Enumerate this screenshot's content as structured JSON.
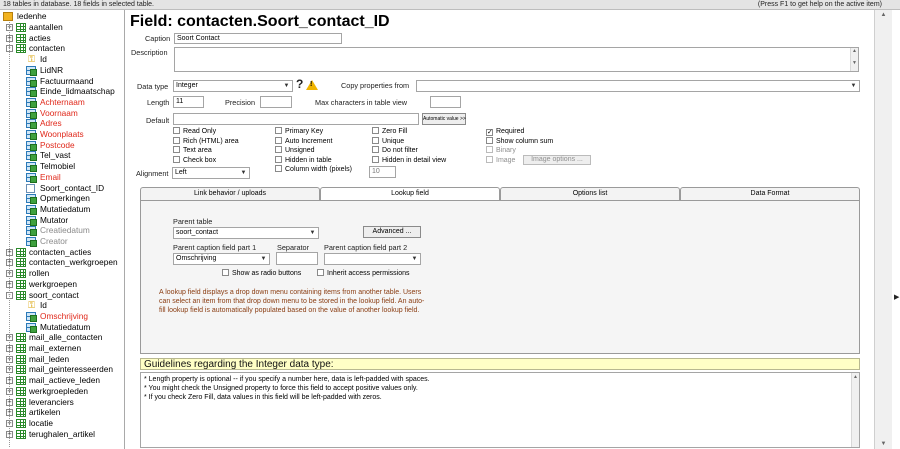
{
  "status_bar": {
    "left": "18 tables in database. 18 fields in selected table.",
    "right": "(Press F1 to get help on the active item)"
  },
  "tree": {
    "root": "ledenhe",
    "items": [
      {
        "label": "aantallen",
        "kind": "table",
        "expander": "+"
      },
      {
        "label": "acties",
        "kind": "table",
        "expander": "+"
      },
      {
        "label": "contacten",
        "kind": "table",
        "expander": "-"
      },
      {
        "label": "Id",
        "kind": "key"
      },
      {
        "label": "LidNR",
        "kind": "field-lookup"
      },
      {
        "label": "Factuurmaand",
        "kind": "field-lookup"
      },
      {
        "label": "Einde_lidmaatschap",
        "kind": "field-lookup"
      },
      {
        "label": "Achternaam",
        "kind": "field-lookup",
        "color": "red"
      },
      {
        "label": "Voornaam",
        "kind": "field-lookup",
        "color": "red"
      },
      {
        "label": "Adres",
        "kind": "field-lookup",
        "color": "red"
      },
      {
        "label": "Woonplaats",
        "kind": "field-lookup",
        "color": "red"
      },
      {
        "label": "Postcode",
        "kind": "field-lookup",
        "color": "red"
      },
      {
        "label": "Tel_vast",
        "kind": "field-lookup"
      },
      {
        "label": "Telmobiel",
        "kind": "field-lookup"
      },
      {
        "label": "Email",
        "kind": "field-lookup",
        "color": "red"
      },
      {
        "label": "Soort_contact_ID",
        "kind": "field"
      },
      {
        "label": "Opmerkingen",
        "kind": "field-lookup"
      },
      {
        "label": "Mutatiedatum",
        "kind": "field-lookup"
      },
      {
        "label": "Mutator",
        "kind": "field-lookup"
      },
      {
        "label": "Creatiedatum",
        "kind": "field-lookup",
        "color": "gray"
      },
      {
        "label": "Creator",
        "kind": "field-lookup",
        "color": "gray"
      },
      {
        "label": "contacten_acties",
        "kind": "table",
        "expander": "+"
      },
      {
        "label": "contacten_werkgroepen",
        "kind": "table",
        "expander": "+"
      },
      {
        "label": "rollen",
        "kind": "table",
        "expander": "+"
      },
      {
        "label": "werkgroepen",
        "kind": "table",
        "expander": "+"
      },
      {
        "label": "soort_contact",
        "kind": "table",
        "expander": "-"
      },
      {
        "label": "Id",
        "kind": "key"
      },
      {
        "label": "Omschrijving",
        "kind": "field-lookup",
        "color": "red"
      },
      {
        "label": "Mutatiedatum",
        "kind": "field-lookup"
      },
      {
        "label": "mail_alle_contacten",
        "kind": "table",
        "expander": "+"
      },
      {
        "label": "mail_externen",
        "kind": "table",
        "expander": "+"
      },
      {
        "label": "mail_leden",
        "kind": "table",
        "expander": "+"
      },
      {
        "label": "mail_geinteresseerden",
        "kind": "table",
        "expander": "+"
      },
      {
        "label": "mail_actieve_leden",
        "kind": "table",
        "expander": "+"
      },
      {
        "label": "werkgroepleden",
        "kind": "table",
        "expander": "+"
      },
      {
        "label": "leveranciers",
        "kind": "table",
        "expander": "+"
      },
      {
        "label": "artikelen",
        "kind": "table",
        "expander": "+"
      },
      {
        "label": "locatie",
        "kind": "table",
        "expander": "+"
      },
      {
        "label": "terughalen_artikel",
        "kind": "table",
        "expander": "+"
      }
    ]
  },
  "field": {
    "title": "Field: contacten.Soort_contact_ID",
    "caption_label": "Caption",
    "caption_value": "Soort Contact",
    "description_label": "Description",
    "data_type_label": "Data type",
    "data_type_value": "Integer",
    "help_glyph": "?",
    "warning_glyph": "!",
    "copy_props_label": "Copy properties from",
    "length_label": "Length",
    "length_value": "11",
    "precision_label": "Precision",
    "max_chars_label": "Max characters in table view",
    "default_label": "Default",
    "automatic_btn": "Automatic value >>",
    "alignment_label": "Alignment",
    "alignment_value": "Left",
    "column_width_value": "10",
    "image_options_btn": "Image options ..."
  },
  "checkboxes": {
    "col1": [
      {
        "label": "Read Only",
        "checked": false
      },
      {
        "label": "Rich (HTML) area",
        "checked": false
      },
      {
        "label": "Text area",
        "checked": false
      },
      {
        "label": "Check box",
        "checked": false
      }
    ],
    "col2": [
      {
        "label": "Primary Key",
        "checked": false
      },
      {
        "label": "Auto Increment",
        "checked": false
      },
      {
        "label": "Unsigned",
        "checked": false
      },
      {
        "label": "Hidden in table",
        "checked": false
      },
      {
        "label": "Column width (pixels)",
        "checked": false
      }
    ],
    "col3": [
      {
        "label": "Zero Fill",
        "checked": false
      },
      {
        "label": "Unique",
        "checked": false
      },
      {
        "label": "Do not filter",
        "checked": false
      },
      {
        "label": "Hidden in detail view",
        "checked": false
      }
    ],
    "col4": [
      {
        "label": "Required",
        "checked": true
      },
      {
        "label": "Show column sum",
        "checked": false
      },
      {
        "label": "Binary",
        "checked": false,
        "disabled": true
      },
      {
        "label": "Image",
        "checked": false,
        "disabled": true
      }
    ]
  },
  "tabs": [
    {
      "label": "Link behavior / uploads",
      "active": false
    },
    {
      "label": "Lookup field",
      "active": true
    },
    {
      "label": "Options list",
      "active": false
    },
    {
      "label": "Data Format",
      "active": false
    }
  ],
  "lookup": {
    "parent_table_label": "Parent table",
    "parent_table_value": "soort_contact",
    "advanced_btn": "Advanced ...",
    "caption1_label": "Parent caption field part 1",
    "caption1_value": "Omschrijving",
    "separator_label": "Separator",
    "caption2_label": "Parent caption field part 2",
    "radio_label": "Show as radio buttons",
    "inherit_label": "Inherit access permissions",
    "note": "A lookup field displays a drop down menu containing items from another table. Users can select an item from that drop down menu to be stored in the lookup field. An auto-fill lookup field is automatically populated based on the value of another lookup field."
  },
  "guidelines": {
    "heading": "Guidelines regarding the Integer data type:",
    "lines": [
      "* Length property is optional -- if you specify a number here, data is left-padded with spaces.",
      "* You might check the Unsigned property to force this field to accept positive values only.",
      "* If you check Zero Fill, data values in this field will be left-padded with zeros."
    ]
  },
  "colors": {
    "required_field": "#e0281a",
    "note_text": "#8a3d12",
    "guideline_bg": "#ffffc6",
    "warning": "#f0b400"
  }
}
